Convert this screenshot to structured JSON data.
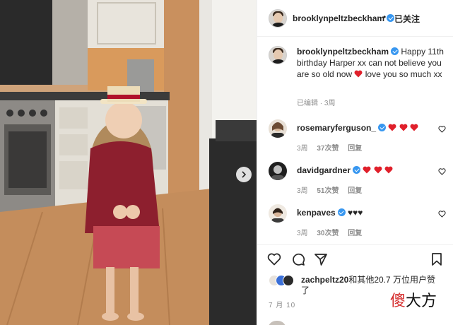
{
  "post": {
    "author": "brooklynpeltzbeckham",
    "follow_label": "已关注",
    "header_dot": "•",
    "more_label": "···",
    "caption_text": "Happy 11th birthday Harper xx can not believe you are so old now",
    "caption_tail": "love you so much xx",
    "caption_meta": "已编辑 · 3周"
  },
  "comments": [
    {
      "user": "rosemaryferguson_",
      "text": "",
      "hearts": 3,
      "time": "3周",
      "likes": "37次赞",
      "reply": "回复"
    },
    {
      "user": "davidgardner",
      "text": "",
      "hearts": 3,
      "time": "3周",
      "likes": "51次赞",
      "reply": "回复"
    },
    {
      "user": "kenpaves",
      "text": "♥♥♥",
      "hearts": 0,
      "time": "3周",
      "likes": "30次赞",
      "reply": "回复"
    }
  ],
  "likes": {
    "user": "zachpeltz20",
    "text": "和其他20.7 万位用户赞了"
  },
  "date": "7 月 10",
  "watermark": {
    "first": "傻",
    "rest": "大方"
  },
  "icons": [
    "heart-icon",
    "comment-icon",
    "share-icon",
    "bookmark-icon",
    "chevron-right-icon",
    "verified-icon"
  ],
  "colors": {
    "heart_red": "#ed4956",
    "verified_blue": "#3897f0",
    "meta_gray": "#8e8e8e"
  }
}
